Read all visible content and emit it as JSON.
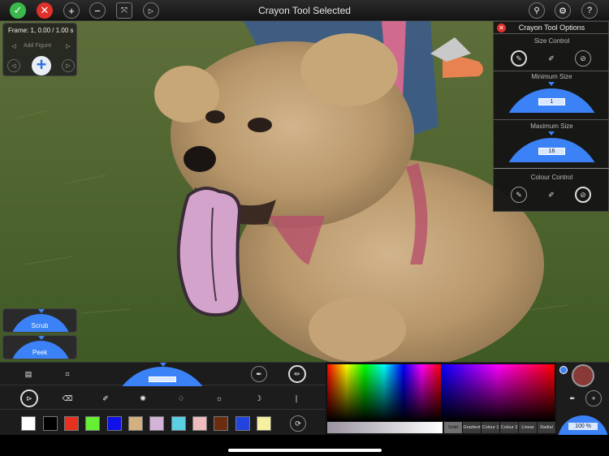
{
  "app": {
    "title": "Crayon Tool Selected"
  },
  "frame_panel": {
    "frame_label": "Frame: 1, 0.00 / 1.00 s",
    "add_figure_label": "Add Figure"
  },
  "gauges": {
    "scrub_label": "Scrub",
    "peek_label": "Peek"
  },
  "options": {
    "title": "Crayon Tool Options",
    "size_control_label": "Size Control",
    "minimum_size_label": "Minimum Size",
    "minimum_size_value": "1",
    "maximum_size_label": "Maximum Size",
    "maximum_size_value": "16",
    "colour_control_label": "Colour Control"
  },
  "palette": [
    "#ffffff",
    "#000000",
    "#e8301f",
    "#66f033",
    "#1010e8",
    "#d3b080",
    "#d4b3d8",
    "#5bd0e2",
    "#eebcbc",
    "#6b2d10",
    "#2244dd",
    "#f6f0a0"
  ],
  "color_modes": [
    "Solid",
    "Gradient",
    "Colour 1",
    "Colour 2",
    "Linear",
    "Radial"
  ],
  "active_color_mode": "Solid",
  "current_color": "#8a3939",
  "opacity_label": "100 %",
  "icons": {
    "top": [
      "check-icon",
      "close-icon",
      "plus-icon",
      "minus-icon",
      "arrows-icon",
      "play-icon",
      "search-icon",
      "gear-icon",
      "help-icon"
    ]
  }
}
